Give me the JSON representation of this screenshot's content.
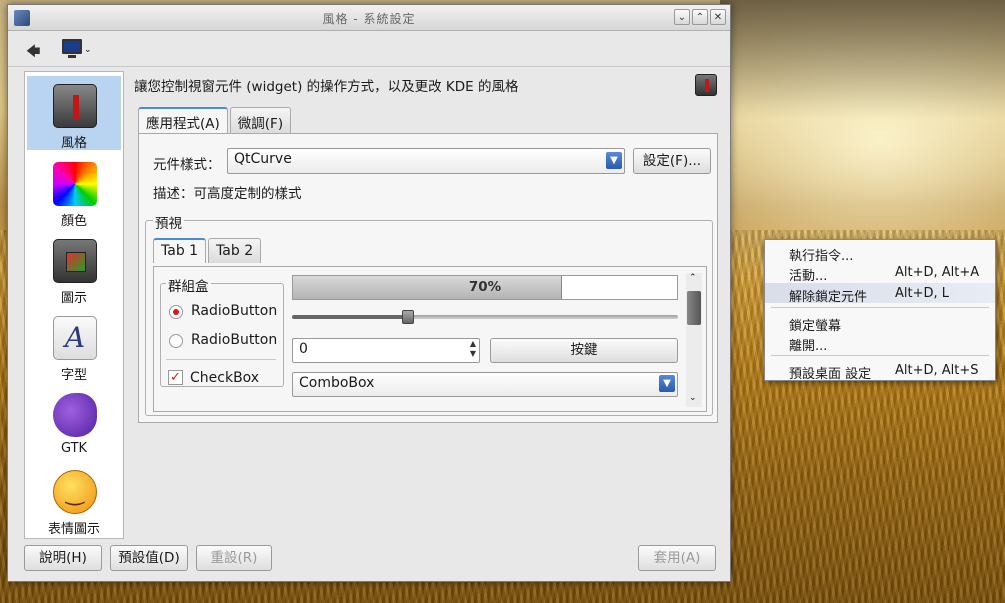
{
  "window": {
    "title": "風格 - 系統設定",
    "buttons": [
      "⌄",
      "⌃",
      "✕"
    ]
  },
  "toolbar": {
    "back_icon": "🡄"
  },
  "sidebar": {
    "items": [
      {
        "label": "風格",
        "icon": "style-icon"
      },
      {
        "label": "顏色",
        "icon": "color-icon"
      },
      {
        "label": "圖示",
        "icon": "icons-icon"
      },
      {
        "label": "字型",
        "icon": "font-icon",
        "glyph": "A"
      },
      {
        "label": "GTK",
        "icon": "gtk-icon"
      },
      {
        "label": "表情圖示",
        "icon": "emoticon-icon"
      }
    ]
  },
  "main": {
    "description": "讓您控制視窗元件 (widget) 的操作方式，以及更改 KDE 的風格",
    "tabs": [
      "應用程式(A)",
      "微調(F)"
    ],
    "widget_style_label": "元件樣式：",
    "widget_style_value": "QtCurve",
    "configure_button": "設定(F)...",
    "style_description": "描述：可高度定制的樣式",
    "preview": {
      "title": "預視",
      "tabs": [
        "Tab 1",
        "Tab 2"
      ],
      "group_title": "群組盒",
      "radio1": "RadioButton",
      "radio2": "RadioButton",
      "checkbox": "CheckBox",
      "progress_text": "70%",
      "progress": 0.7,
      "slider": 0.3,
      "spin_value": "0",
      "push_button": "按鍵",
      "combobox": "ComboBox"
    }
  },
  "bottom": {
    "help": "說明(H)",
    "defaults": "預設值(D)",
    "reset": "重設(R)",
    "apply": "套用(A)"
  },
  "context_menu": {
    "items": [
      {
        "label": "執行指令...",
        "shortcut": ""
      },
      {
        "label": "活動...",
        "shortcut": "Alt+D, Alt+A"
      },
      {
        "label": "解除鎖定元件",
        "shortcut": "Alt+D, L"
      },
      {
        "label": "鎖定螢幕",
        "shortcut": ""
      },
      {
        "label": "離開...",
        "shortcut": ""
      },
      {
        "label": "預設桌面 設定",
        "shortcut": "Alt+D, Alt+S"
      }
    ]
  }
}
